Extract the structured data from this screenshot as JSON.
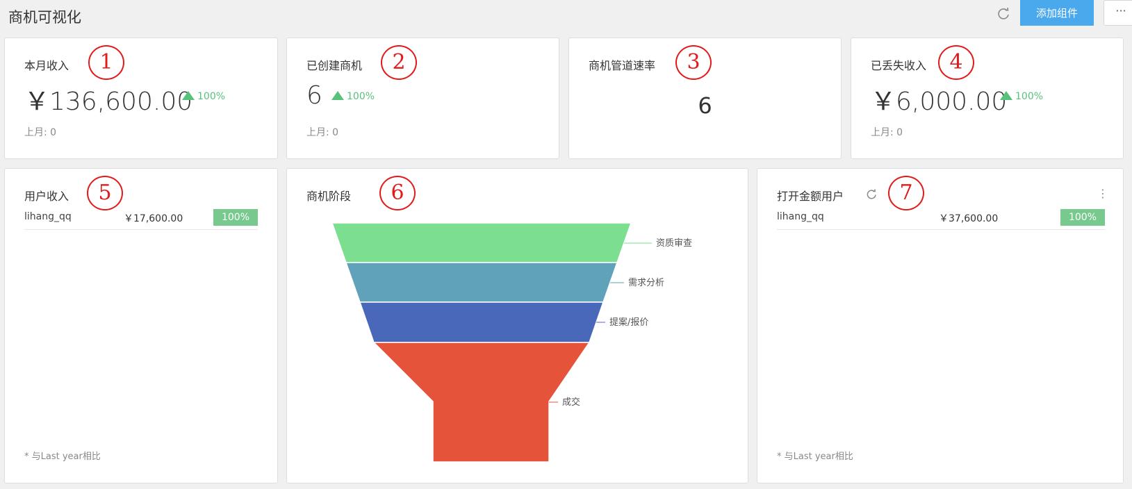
{
  "header": {
    "title": "商机可视化",
    "add_button": "添加组件",
    "more_button": "···"
  },
  "kpis": [
    {
      "title": "本月收入",
      "annot": "1",
      "value": "￥136,600.00",
      "trend": "100%",
      "last": "上月: 0"
    },
    {
      "title": "已创建商机",
      "annot": "2",
      "value": "6",
      "trend": "100%",
      "last": "上月: 0"
    },
    {
      "title": "商机管道速率",
      "annot": "3",
      "value": "6"
    },
    {
      "title": "已丢失收入",
      "annot": "4",
      "value": "￥6,000.00",
      "trend": "100%",
      "last": "上月: 0"
    }
  ],
  "user_income": {
    "title": "用户收入",
    "annot": "5",
    "rows": [
      {
        "name": "lihang_qq",
        "amount": "￥17,600.00",
        "percent": "100%"
      }
    ],
    "footnote": "* 与Last year相比"
  },
  "stage": {
    "title": "商机阶段",
    "annot": "6"
  },
  "open_amount": {
    "title": "打开金额用户",
    "annot": "7",
    "rows": [
      {
        "name": "lihang_qq",
        "amount": "￥37,600.00",
        "percent": "100%"
      }
    ],
    "footnote": "* 与Last year相比",
    "menu": "⋮"
  },
  "chart_data": {
    "type": "funnel",
    "title": "商机阶段",
    "stages": [
      {
        "name": "资质审查",
        "color": "#7bdf8f"
      },
      {
        "name": "需求分析",
        "color": "#61a2bb"
      },
      {
        "name": "提案/报价",
        "color": "#4a68b9"
      },
      {
        "name": "成交",
        "color": "#e5533a"
      }
    ]
  },
  "colors": {
    "accent": "#4aa8ec",
    "positive": "#58c17c",
    "badge": "#78c98d",
    "annotation": "#e01b1b"
  }
}
